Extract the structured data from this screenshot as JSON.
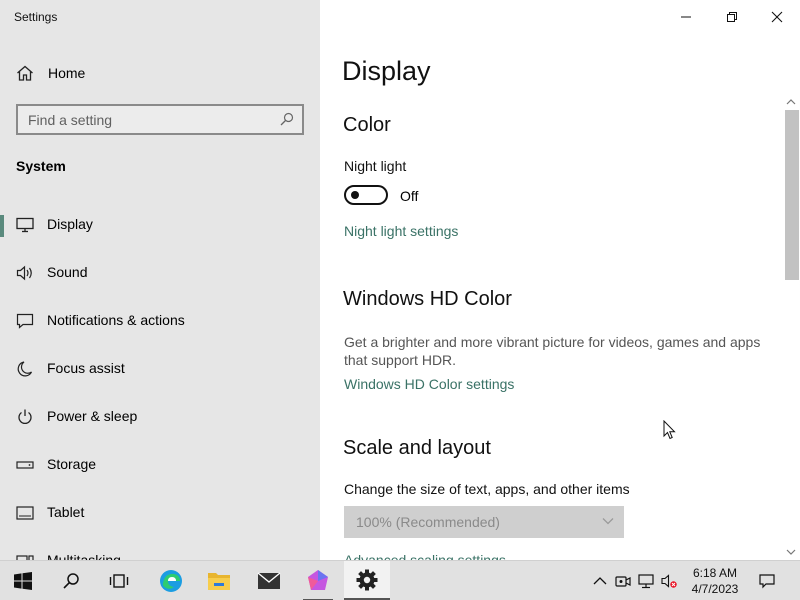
{
  "window": {
    "title": "Settings",
    "minimize_icon": "minimize-icon",
    "maximize_icon": "restore-icon",
    "close_icon": "close-icon"
  },
  "sidebar": {
    "home_label": "Home",
    "search_placeholder": "Find a setting",
    "section_title": "System",
    "items": [
      {
        "label": "Display",
        "icon": "monitor-icon",
        "active": true
      },
      {
        "label": "Sound",
        "icon": "speaker-icon"
      },
      {
        "label": "Notifications & actions",
        "icon": "notification-icon"
      },
      {
        "label": "Focus assist",
        "icon": "moon-icon"
      },
      {
        "label": "Power & sleep",
        "icon": "power-icon"
      },
      {
        "label": "Storage",
        "icon": "storage-icon"
      },
      {
        "label": "Tablet",
        "icon": "tablet-icon"
      },
      {
        "label": "Multitasking",
        "icon": "multitasking-icon"
      }
    ]
  },
  "main": {
    "title": "Display",
    "color": {
      "heading": "Color",
      "night_light_label": "Night light",
      "night_light_state": "Off",
      "night_light_on": false,
      "night_light_link": "Night light settings"
    },
    "hd_color": {
      "heading": "Windows HD Color",
      "description": "Get a brighter and more vibrant picture for videos, games and apps that support HDR.",
      "link": "Windows HD Color settings"
    },
    "scale": {
      "heading": "Scale and layout",
      "size_label": "Change the size of text, apps, and other items",
      "size_value": "100% (Recommended)",
      "advanced_link": "Advanced scaling settings"
    }
  },
  "taskbar": {
    "apps": [
      "start-icon",
      "search-icon",
      "task-view-icon",
      "edge-icon",
      "file-explorer-icon",
      "mail-icon",
      "app-icon",
      "settings-icon"
    ],
    "time": "6:18 AM",
    "date": "4/7/2023"
  },
  "colors": {
    "accent": "#5a8a7d",
    "link": "#3a7266",
    "sidebar_bg": "#e6e6e6"
  }
}
